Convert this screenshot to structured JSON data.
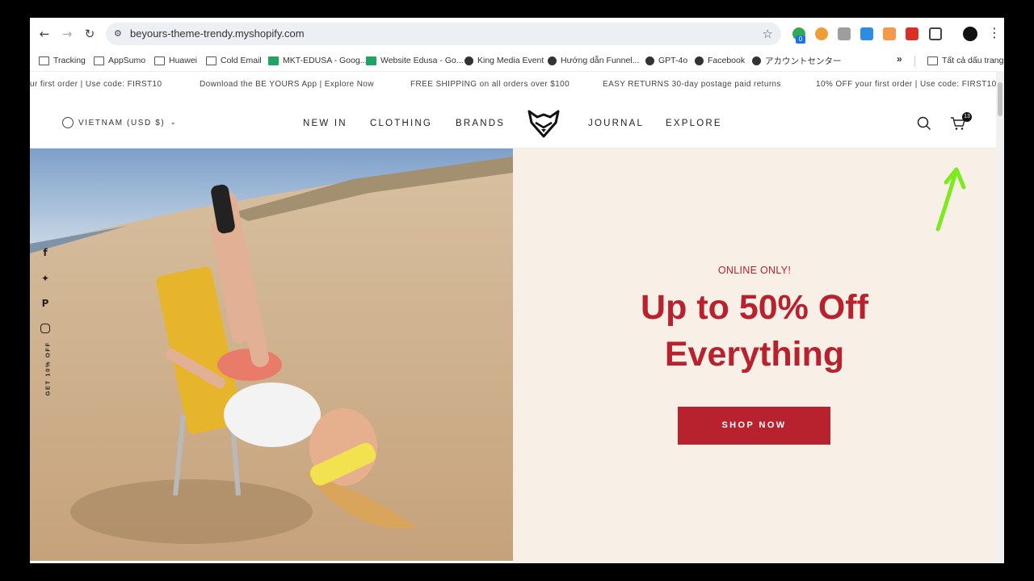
{
  "browser": {
    "url": "beyours-theme-trendy.myshopify.com",
    "extension_badge": "0",
    "bookmarks": [
      {
        "label": "Tracking",
        "icon": "folder-icon"
      },
      {
        "label": "AppSumo",
        "icon": "folder-icon"
      },
      {
        "label": "Huawei",
        "icon": "folder-icon"
      },
      {
        "label": "Cold Email",
        "icon": "folder-icon"
      },
      {
        "label": "MKT-EDUSA - Goog...",
        "icon": "sheets-icon"
      },
      {
        "label": "Website Edusa - Go...",
        "icon": "sheets-icon"
      },
      {
        "label": "King Media Event",
        "icon": "globe-icon"
      },
      {
        "label": "Hướng dẫn Funnel...",
        "icon": "globe-icon"
      },
      {
        "label": "GPT-4o",
        "icon": "globe-icon"
      },
      {
        "label": "Facebook",
        "icon": "globe-icon"
      },
      {
        "label": "アカウントセンター",
        "icon": "globe-icon"
      }
    ],
    "more_bookmarks": "»",
    "all_bookmarks": "Tất cả dấu trang"
  },
  "announcement": [
    "ur first order | Use code: FIRST10",
    "Download the BE YOURS App | Explore Now",
    "FREE SHIPPING on all orders over $100",
    "EASY RETURNS 30-day postage paid returns",
    "10% OFF your first order | Use code: FIRST10"
  ],
  "header": {
    "locale": "VIETNAM (USD $)",
    "nav_left": [
      "NEW IN",
      "CLOTHING",
      "BRANDS"
    ],
    "nav_right": [
      "JOURNAL",
      "EXPLORE"
    ],
    "cart_count": "13"
  },
  "hero": {
    "eyebrow": "ONLINE ONLY!",
    "headline_line1": "Up to 50% Off",
    "headline_line2": "Everything",
    "cta": "SHOP NOW",
    "accent_color": "#b8222e",
    "panel_color": "#f8f0e7"
  },
  "social": {
    "icons": [
      "facebook-icon",
      "twitter-icon",
      "pinterest-icon",
      "instagram-icon"
    ],
    "promo": "GET 10% OFF"
  }
}
